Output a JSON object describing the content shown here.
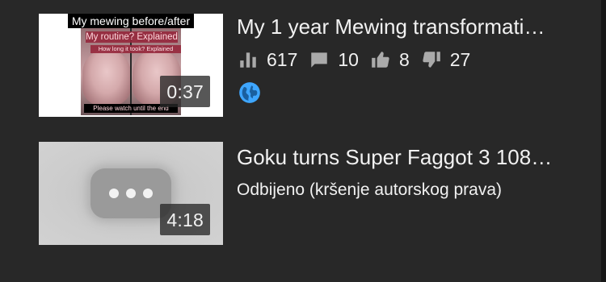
{
  "videos": [
    {
      "title": "My 1 year Mewing transformati…",
      "duration": "0:37",
      "thumbnail_captions": {
        "heading": "My mewing before/after",
        "line2": "My routine? Explained",
        "line3": "How long it took? Explained",
        "footer": "Please watch until the end"
      },
      "stats": {
        "views": "617",
        "comments": "10",
        "likes": "8",
        "dislikes": "27"
      },
      "visibility_icon": "globe-icon",
      "accent_color": "#3ea6ff"
    },
    {
      "title": "Goku turns Super Faggot 3 108…",
      "duration": "4:18",
      "status": "Odbijeno (kršenje autorskog prava)",
      "thumbnail_icon": "more-dots-icon"
    }
  ],
  "icons": {
    "views": "bar-chart-icon",
    "comments": "comment-icon",
    "likes": "thumbs-up-icon",
    "dislikes": "thumbs-down-icon"
  },
  "colors": {
    "background": "#282828",
    "text": "#f1f1f1",
    "icon": "#aaaaaa",
    "globe": "#3ea6ff"
  }
}
